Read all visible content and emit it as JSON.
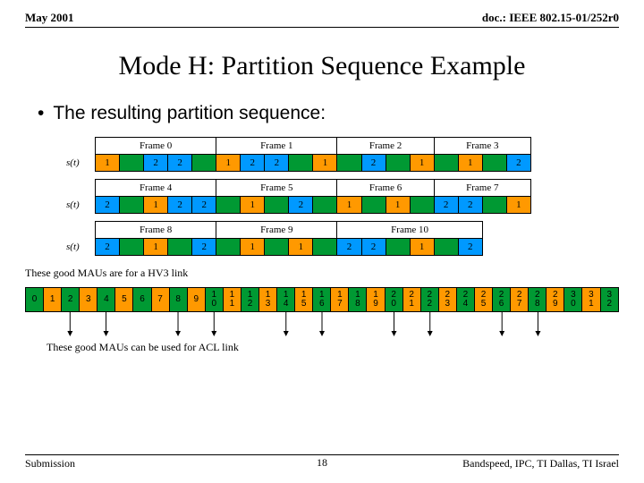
{
  "header": {
    "date": "May 2001",
    "doc": "doc.: IEEE 802.15-01/252r0"
  },
  "title": "Mode H: Partition Sequence Example",
  "bullet": "The resulting partition sequence:",
  "st_label": "s(t)",
  "fig": {
    "groups": [
      {
        "frames": [
          "Frame 0",
          "Frame 1",
          "Frame 2",
          "Frame 3"
        ],
        "vals": [
          [
            "1",
            "orange"
          ],
          [
            "",
            "green"
          ],
          [
            "2",
            "blue"
          ],
          [
            "2",
            "blue"
          ],
          [
            "",
            "green"
          ],
          [
            "1",
            "orange"
          ],
          [
            "2",
            "blue"
          ],
          [
            "2",
            "blue"
          ],
          [
            "",
            "green"
          ],
          [
            "1",
            "orange"
          ],
          [
            "",
            "green"
          ],
          [
            "2",
            "blue"
          ],
          [
            "",
            "green"
          ],
          [
            "1",
            "orange"
          ],
          [
            "",
            "green"
          ],
          [
            "1",
            "orange"
          ],
          [
            "",
            "green"
          ],
          [
            "2",
            "blue"
          ]
        ]
      },
      {
        "frames": [
          "Frame 4",
          "Frame 5",
          "Frame 6",
          "Frame 7"
        ],
        "vals": [
          [
            "2",
            "blue"
          ],
          [
            "",
            "green"
          ],
          [
            "1",
            "orange"
          ],
          [
            "2",
            "blue"
          ],
          [
            "2",
            "blue"
          ],
          [
            "",
            "green"
          ],
          [
            "1",
            "orange"
          ],
          [
            "",
            "green"
          ],
          [
            "2",
            "blue"
          ],
          [
            "",
            "green"
          ],
          [
            "1",
            "orange"
          ],
          [
            "",
            "green"
          ],
          [
            "1",
            "orange"
          ],
          [
            "",
            "green"
          ],
          [
            "2",
            "blue"
          ],
          [
            "2",
            "blue"
          ],
          [
            "",
            "green"
          ],
          [
            "1",
            "orange"
          ]
        ]
      },
      {
        "frames": [
          "Frame 8",
          "Frame 9",
          "Frame 10"
        ],
        "short": true,
        "vals": [
          [
            "2",
            "blue"
          ],
          [
            "",
            "green"
          ],
          [
            "1",
            "orange"
          ],
          [
            "",
            "green"
          ],
          [
            "2",
            "blue"
          ],
          [
            "",
            "green"
          ],
          [
            "1",
            "orange"
          ],
          [
            "",
            "green"
          ],
          [
            "1",
            "orange"
          ],
          [
            "",
            "green"
          ],
          [
            "2",
            "blue"
          ],
          [
            "2",
            "blue"
          ],
          [
            "",
            "green"
          ],
          [
            "1",
            "orange"
          ],
          [
            "",
            "green"
          ],
          [
            "2",
            "blue"
          ]
        ]
      }
    ]
  },
  "note1": "These good MAUs are for a HV3 link",
  "mau": {
    "count": 33,
    "colors": [
      "green",
      "orange",
      "green",
      "orange",
      "green",
      "orange",
      "green",
      "orange",
      "green",
      "orange",
      "green",
      "orange",
      "green",
      "orange",
      "green",
      "orange",
      "green",
      "orange",
      "green",
      "orange",
      "green",
      "orange",
      "green",
      "orange",
      "green",
      "orange",
      "green",
      "orange",
      "green",
      "orange",
      "green",
      "orange",
      "green"
    ],
    "arrows_from": [
      2,
      4,
      8,
      10,
      14,
      16,
      20,
      22,
      26,
      28
    ]
  },
  "note2": "These good MAUs can be used for ACL link",
  "footer": {
    "left": "Submission",
    "page": "18",
    "right": "Bandspeed, IPC, TI Dallas, TI Israel"
  }
}
